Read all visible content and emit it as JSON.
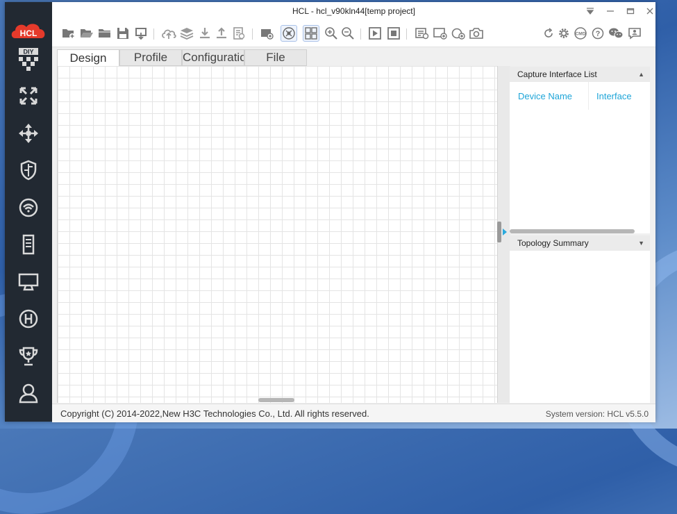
{
  "window": {
    "title": "HCL - hcl_v90kln44[temp project]"
  },
  "logo_text": "HCL",
  "sidebar": {
    "diy_label": "DIY",
    "items": [
      {
        "icon": "diy-icon"
      },
      {
        "icon": "router-icon"
      },
      {
        "icon": "switch-icon"
      },
      {
        "icon": "firewall-icon"
      },
      {
        "icon": "wireless-icon"
      },
      {
        "icon": "server-icon"
      },
      {
        "icon": "terminal-icon"
      },
      {
        "icon": "h3c-device-icon"
      },
      {
        "icon": "trophy-icon"
      },
      {
        "icon": "user-icon"
      }
    ]
  },
  "tabs": [
    {
      "label": "Design",
      "active": true
    },
    {
      "label": "Profile",
      "active": false
    },
    {
      "label": "Configuration",
      "active": false
    },
    {
      "label": "File",
      "active": false
    }
  ],
  "capture_panel": {
    "title": "Capture Interface List",
    "columns": [
      "Device Name",
      "Interface"
    ]
  },
  "topology_panel": {
    "title": "Topology Summary"
  },
  "status": {
    "copyright": "Copyright (C) 2014-2022,New H3C Technologies Co., Ltd. All rights reserved.",
    "version": "System version: HCL v5.5.0"
  },
  "colors": {
    "sidebar_bg": "#222932",
    "accent": "#1ea5d8",
    "logo_red": "#e53a2b"
  }
}
